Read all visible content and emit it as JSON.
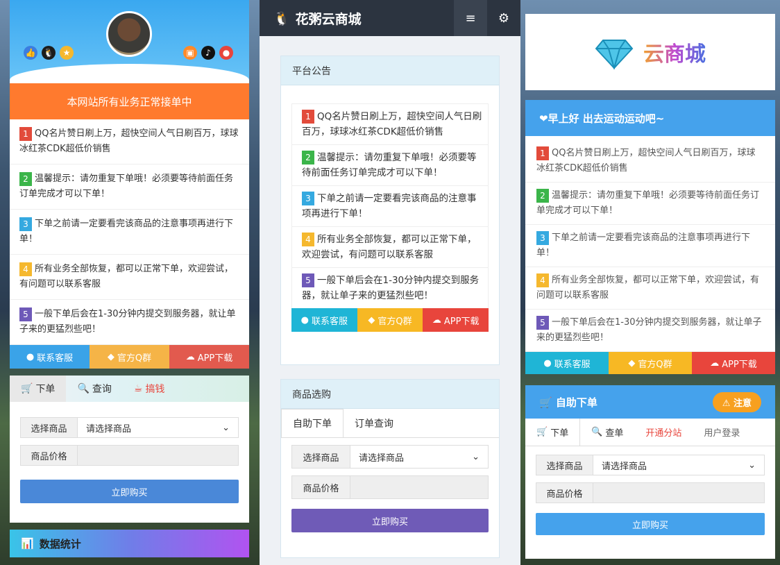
{
  "notices": [
    {
      "num": "1",
      "text": "QQ名片赞日刷上万，超快空间人气日刷百万，球球冰红茶CDK超低价销售"
    },
    {
      "num": "2",
      "text": "温馨提示：请勿重复下单哦！必须要等待前面任务订单完成才可以下单！"
    },
    {
      "num": "3",
      "text": "下单之前请一定要看完该商品的注意事项再进行下单！"
    },
    {
      "num": "4",
      "text": "所有业务全部恢复，都可以正常下单，欢迎尝试，有问题可以联系客服"
    },
    {
      "num": "5",
      "text": "一般下单后会在1-30分钟内提交到服务器，就让单子来的更猛烈些吧！"
    }
  ],
  "col1": {
    "banner": "本网站所有业务正常接单中",
    "btn_service": "联系客服",
    "btn_qq": "官方Q群",
    "btn_app": "APP下载",
    "tab_order": "下单",
    "tab_query": "查询",
    "tab_earn": "搞钱",
    "label_product": "选择商品",
    "select_placeholder": "请选择商品",
    "label_price": "商品价格",
    "buy": "立即购买",
    "stats": "数据统计"
  },
  "col2": {
    "brand": "花粥云商城",
    "announce_title": "平台公告",
    "btn_service": "联系客服",
    "btn_qq": "官方Q群",
    "btn_app": "APP下载",
    "shop_title": "商品选购",
    "tab_self": "自助下单",
    "tab_query": "订单查询",
    "label_product": "选择商品",
    "select_placeholder": "请选择商品",
    "label_price": "商品价格",
    "buy": "立即购买"
  },
  "col3": {
    "logo_text": "云商城",
    "greeting": "❤早上好 出去运动运动吧~",
    "btn_service": "联系客服",
    "btn_qq": "官方Q群",
    "btn_app": "APP下载",
    "self_title": "自助下单",
    "notice_btn": "注意",
    "tab_order": "下单",
    "tab_query": "查单",
    "tab_sub": "开通分站",
    "tab_login": "用户登录",
    "label_product": "选择商品",
    "select_placeholder": "请选择商品",
    "label_price": "商品价格",
    "buy": "立即购买"
  },
  "colors": {
    "orange": "#ff7a2e",
    "cyan": "#1fb5d6",
    "yellow": "#f7b824",
    "red": "#e8453c",
    "purple": "#6f5bb7",
    "blue": "#45a2ec"
  }
}
